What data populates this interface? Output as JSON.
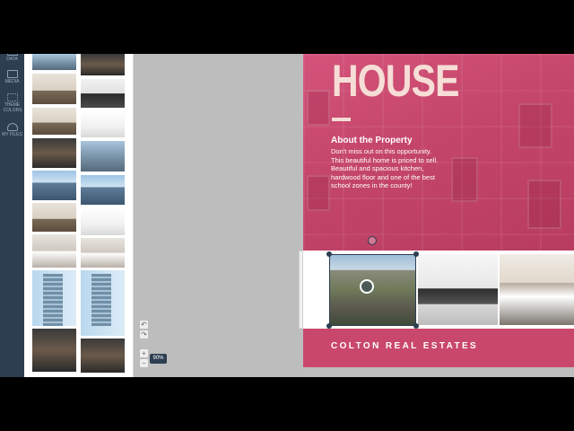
{
  "rail": {
    "items": [
      {
        "label": "DATA",
        "icon": "data-icon"
      },
      {
        "label": "MEDIA",
        "icon": "media-icon"
      },
      {
        "label": "THEME COLORS",
        "icon": "theme-colors-icon"
      },
      {
        "label": "MY FILES",
        "icon": "cloud-icon"
      }
    ]
  },
  "zoom": {
    "label": "90%"
  },
  "design": {
    "title": "HOUSE",
    "about_heading": "About the Property",
    "about_body": "Don't miss out on this opportunity. This beautiful home is priced to sell. Beautiful and spacious kitchen, hardwood floor and one of the best school zones in the county!",
    "footer": "COLTON REAL ESTATES"
  },
  "colors": {
    "accent": "#c9476b",
    "rail": "#2c3e50",
    "title_text": "#f6ded6"
  }
}
